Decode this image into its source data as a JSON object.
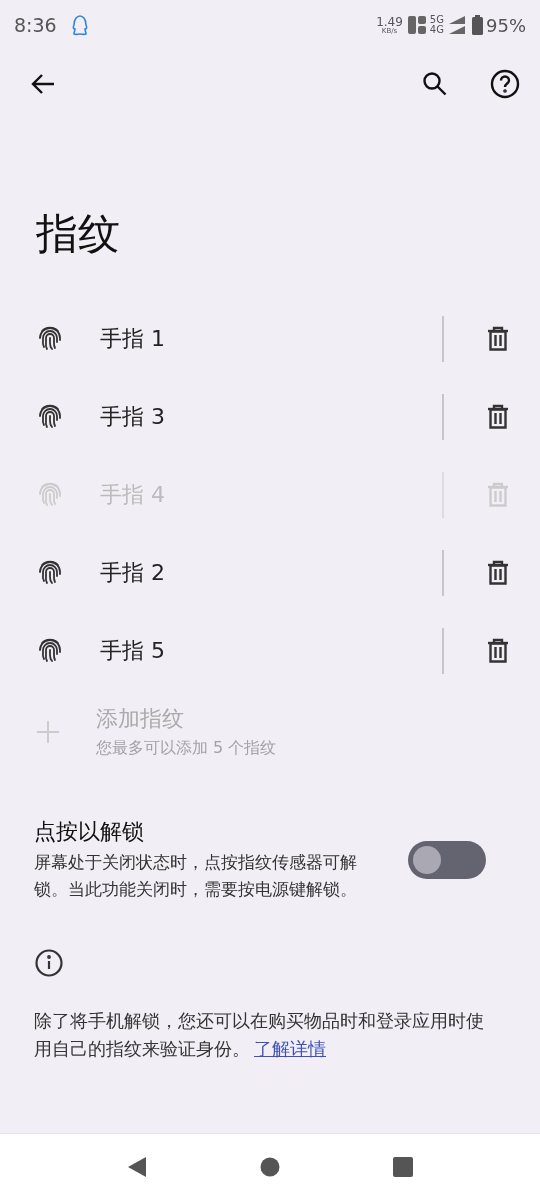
{
  "status_bar": {
    "time": "8:36",
    "speed": "1.49",
    "speed_unit": "KB/s",
    "network_top": "5G",
    "network_bottom": "4G",
    "battery": "95%"
  },
  "title": "指纹",
  "fingerprints": [
    {
      "name": "手指 1",
      "disabled": false
    },
    {
      "name": "手指 3",
      "disabled": false
    },
    {
      "name": "手指 4",
      "disabled": true
    },
    {
      "name": "手指 2",
      "disabled": false
    },
    {
      "name": "手指 5",
      "disabled": false
    }
  ],
  "add_item": {
    "label": "添加指纹",
    "hint": "您最多可以添加 5 个指纹",
    "disabled": true
  },
  "tap_unlock": {
    "title": "点按以解锁",
    "description": "屏幕处于关闭状态时，点按指纹传感器可解锁。当此功能关闭时，需要按电源键解锁。",
    "on": false
  },
  "info": {
    "text": "除了将手机解锁，您还可以在购买物品时和登录应用时使用自己的指纹来验证身份。",
    "link": "了解详情"
  }
}
